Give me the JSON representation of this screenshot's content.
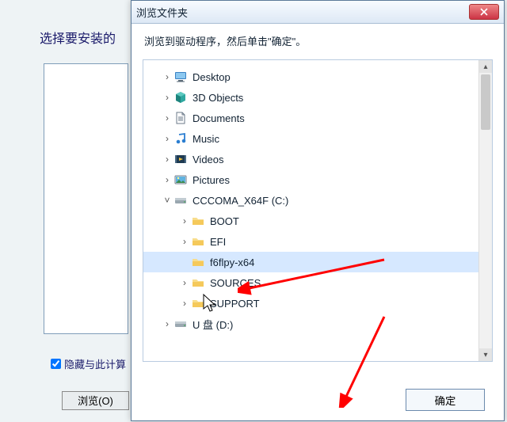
{
  "background": {
    "title_partial": "选择要安装的",
    "hide_checkbox_label_partial": "隐藏与此计算",
    "browse_button": "浏览(O)"
  },
  "dialog": {
    "title": "浏览文件夹",
    "instruction": "浏览到驱动程序，然后单击\"确定\"。",
    "ok_button": "确定"
  },
  "tree": {
    "items": [
      {
        "level": 1,
        "exp": ">",
        "icon": "desktop",
        "label": "Desktop"
      },
      {
        "level": 1,
        "exp": ">",
        "icon": "3d",
        "label": "3D Objects"
      },
      {
        "level": 1,
        "exp": ">",
        "icon": "doc",
        "label": "Documents"
      },
      {
        "level": 1,
        "exp": ">",
        "icon": "music",
        "label": "Music"
      },
      {
        "level": 1,
        "exp": ">",
        "icon": "video",
        "label": "Videos"
      },
      {
        "level": 1,
        "exp": ">",
        "icon": "pic",
        "label": "Pictures"
      },
      {
        "level": 1,
        "exp": "v",
        "icon": "drive",
        "label": "CCCOMA_X64F (C:)"
      },
      {
        "level": 2,
        "exp": ">",
        "icon": "folder",
        "label": "BOOT"
      },
      {
        "level": 2,
        "exp": ">",
        "icon": "folder",
        "label": "EFI"
      },
      {
        "level": 2,
        "exp": "",
        "icon": "folder",
        "label": "f6flpy-x64",
        "selected": true
      },
      {
        "level": 2,
        "exp": ">",
        "icon": "folder",
        "label": "SOURCES"
      },
      {
        "level": 2,
        "exp": ">",
        "icon": "folder",
        "label": "SUPPORT"
      },
      {
        "level": 1,
        "exp": ">",
        "icon": "drive",
        "label": "U 盘 (D:)"
      }
    ]
  }
}
